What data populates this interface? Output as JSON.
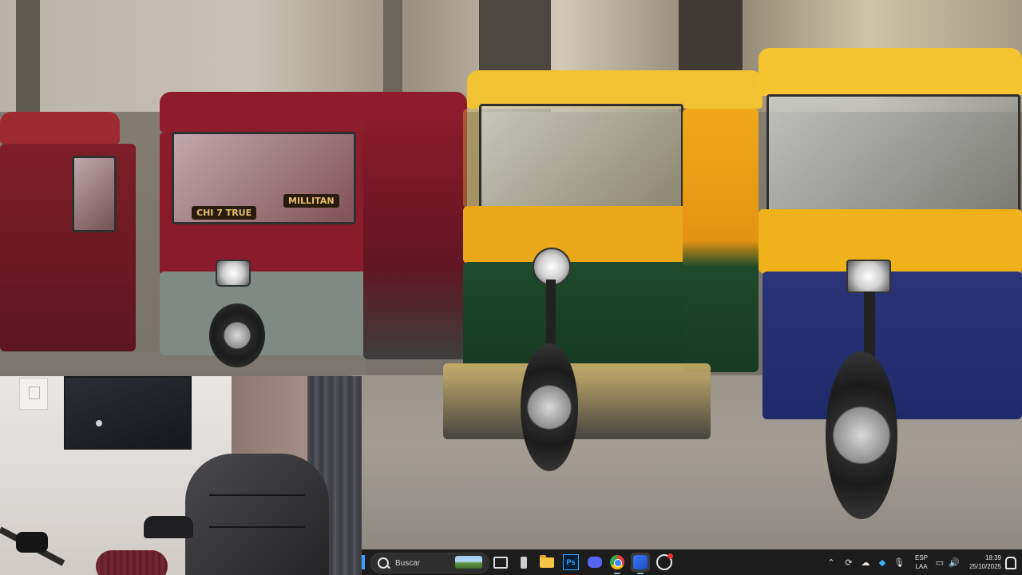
{
  "taskbar": {
    "search": {
      "placeholder": "Buscar"
    },
    "pinned_icons": [
      "task-view-icon",
      "usb-device-icon",
      "file-explorer-icon",
      "photoshop-icon",
      "discord-icon",
      "chrome-icon",
      "xbox-game-bar-icon",
      "obs-icon"
    ],
    "photoshop_label": "Ps",
    "tray": {
      "overflow_glyph": "⌃",
      "language_line1": "ESP",
      "language_line2": "LAA",
      "time": "18:39",
      "date": "25/10/2025"
    }
  },
  "video": {
    "sign_left": "MILLITAN",
    "sign_left2": "CHI 7 TRUE"
  },
  "colors": {
    "taskbar_bg": "#1c1c1c",
    "mototaxi_red": "#8d1c2c",
    "mototaxi_yellow": "#f0b21a",
    "mototaxi_green": "#1f4a2b",
    "mototaxi_blue": "#1f2a6a"
  }
}
